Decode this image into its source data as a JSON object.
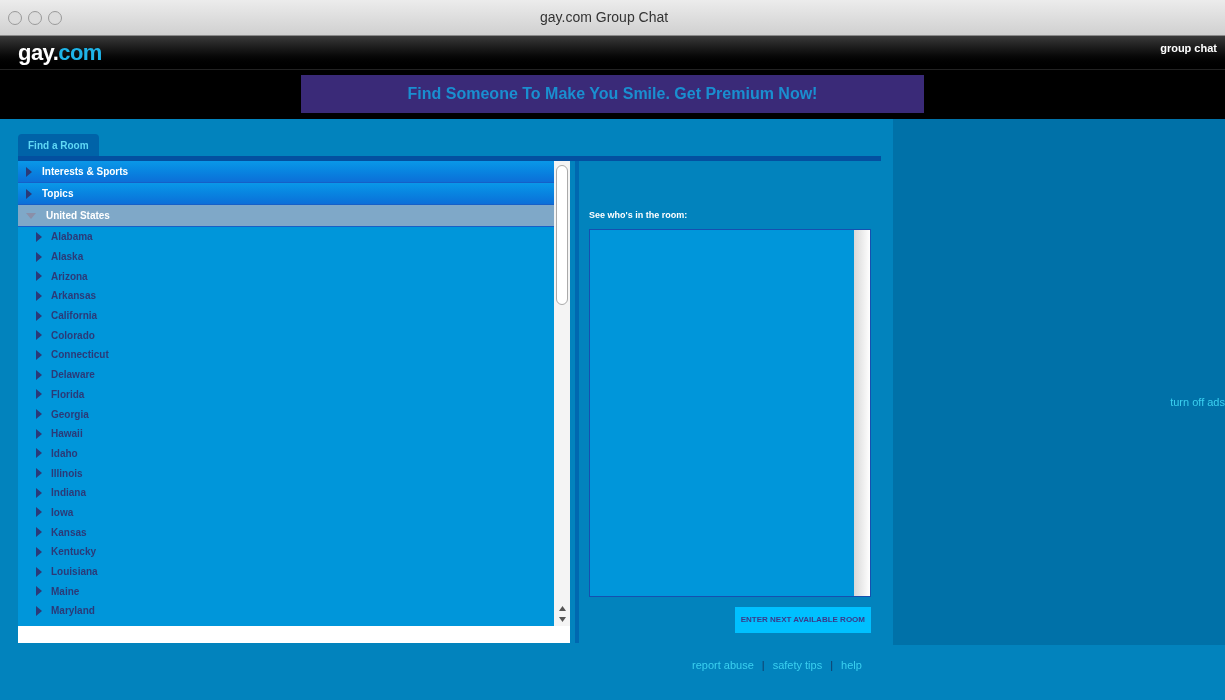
{
  "window": {
    "title": "gay.com Group Chat"
  },
  "header": {
    "logo": {
      "main": "gay.",
      "accent": "com"
    },
    "section": "group chat"
  },
  "banner": {
    "text": "Find Someone To Make You Smile. Get Premium Now!"
  },
  "tabs": [
    {
      "label": "Find a Room",
      "selected": true
    }
  ],
  "room_tree": [
    {
      "label": "Interests & Sports",
      "expanded": false,
      "selected": false
    },
    {
      "label": "Topics",
      "expanded": false,
      "selected": false
    },
    {
      "label": "United States",
      "expanded": true,
      "selected": true,
      "children": [
        {
          "label": "Alabama",
          "expanded": false
        },
        {
          "label": "Alaska",
          "expanded": false
        },
        {
          "label": "Arizona",
          "expanded": false
        },
        {
          "label": "Arkansas",
          "expanded": false
        },
        {
          "label": "California",
          "expanded": false
        },
        {
          "label": "Colorado",
          "expanded": false
        },
        {
          "label": "Connecticut",
          "expanded": false
        },
        {
          "label": "Delaware",
          "expanded": false
        },
        {
          "label": "Florida",
          "expanded": false
        },
        {
          "label": "Georgia",
          "expanded": false
        },
        {
          "label": "Hawaii",
          "expanded": false
        },
        {
          "label": "Idaho",
          "expanded": false
        },
        {
          "label": "Illinois",
          "expanded": false
        },
        {
          "label": "Indiana",
          "expanded": false
        },
        {
          "label": "Iowa",
          "expanded": false
        },
        {
          "label": "Kansas",
          "expanded": false
        },
        {
          "label": "Kentucky",
          "expanded": false
        },
        {
          "label": "Louisiana",
          "expanded": false
        },
        {
          "label": "Maine",
          "expanded": false
        },
        {
          "label": "Maryland",
          "expanded": false
        }
      ]
    }
  ],
  "room_panel": {
    "label": "See who's in the room:",
    "button": "ENTER NEXT AVAILABLE ROOM"
  },
  "ad_panel": {
    "link": "turn off ads"
  },
  "footer": [
    {
      "kind": "link",
      "text": "report abuse"
    },
    {
      "kind": "separator",
      "text": "|"
    },
    {
      "kind": "link",
      "text": "safety tips"
    },
    {
      "kind": "separator",
      "text": "|"
    },
    {
      "kind": "link",
      "text": "help"
    }
  ]
}
